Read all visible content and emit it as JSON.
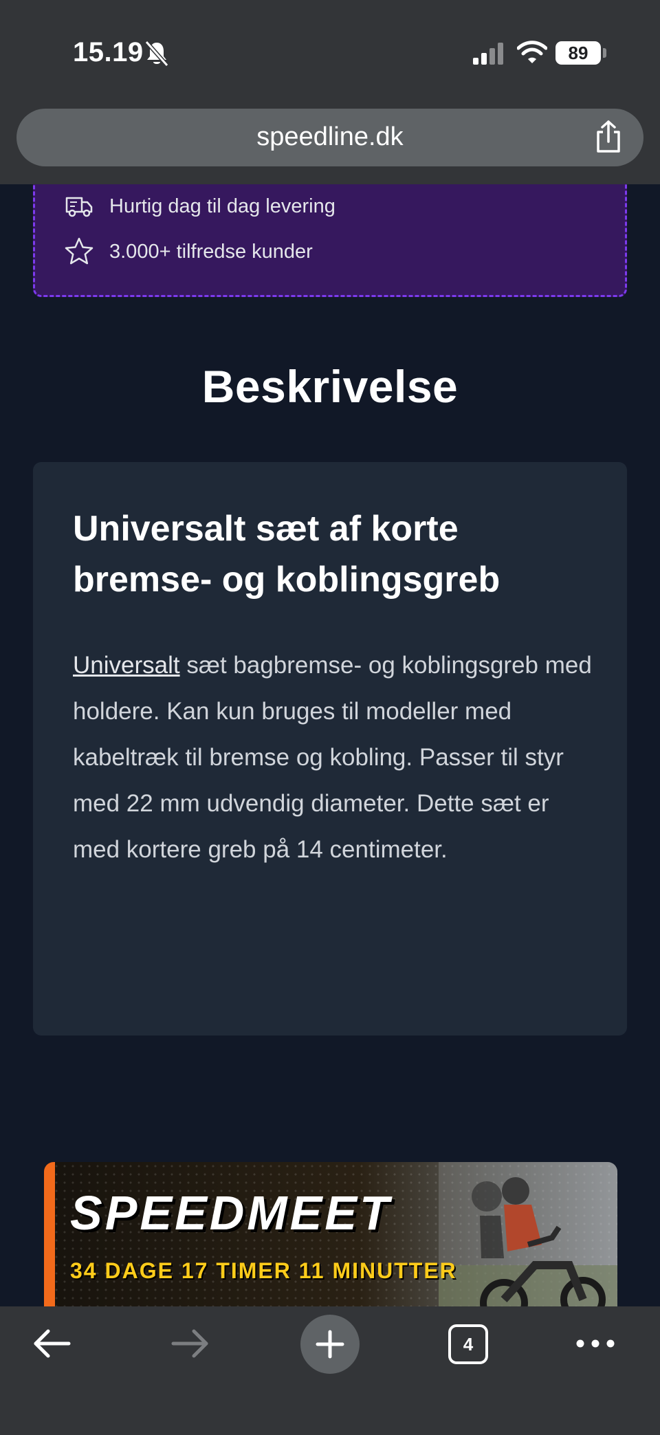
{
  "status_bar": {
    "time": "15.19",
    "battery": "89",
    "icons": [
      "bell-slash-icon",
      "signal-icon",
      "wifi-icon",
      "battery-icon"
    ]
  },
  "browser": {
    "url": "speedline.dk",
    "share_icon": "share-icon",
    "tab_count": "4"
  },
  "trust": {
    "items": [
      {
        "icon": "delivery-truck-icon",
        "label": "Hurtig dag til dag levering"
      },
      {
        "icon": "star-icon",
        "label": "3.000+ tilfredse kunder"
      }
    ]
  },
  "description": {
    "heading": "Beskrivelse",
    "title": "Universalt sæt af korte bremse- og koblingsgreb",
    "link_text": "Universalt",
    "body_rest": " sæt bagbremse- og koblingsgreb med holdere. Kan kun bruges til modeller med kabeltræk til bremse og kobling. Passer til styr med 22 mm udvendig diameter. Dette sæt er med kortere greb på 14 centimeter."
  },
  "promo": {
    "title": "SPEEDMEET",
    "countdown": "34 DAGE 17 TIMER 11 MINUTTER"
  },
  "colors": {
    "page_bg": "#111827",
    "card_bg": "#1f2937",
    "trust_bg": "#36185e",
    "trust_border": "#7c3aed",
    "promo_accent": "#f26a1b",
    "countdown": "#ffcc1a",
    "browser_chrome": "#333538"
  }
}
